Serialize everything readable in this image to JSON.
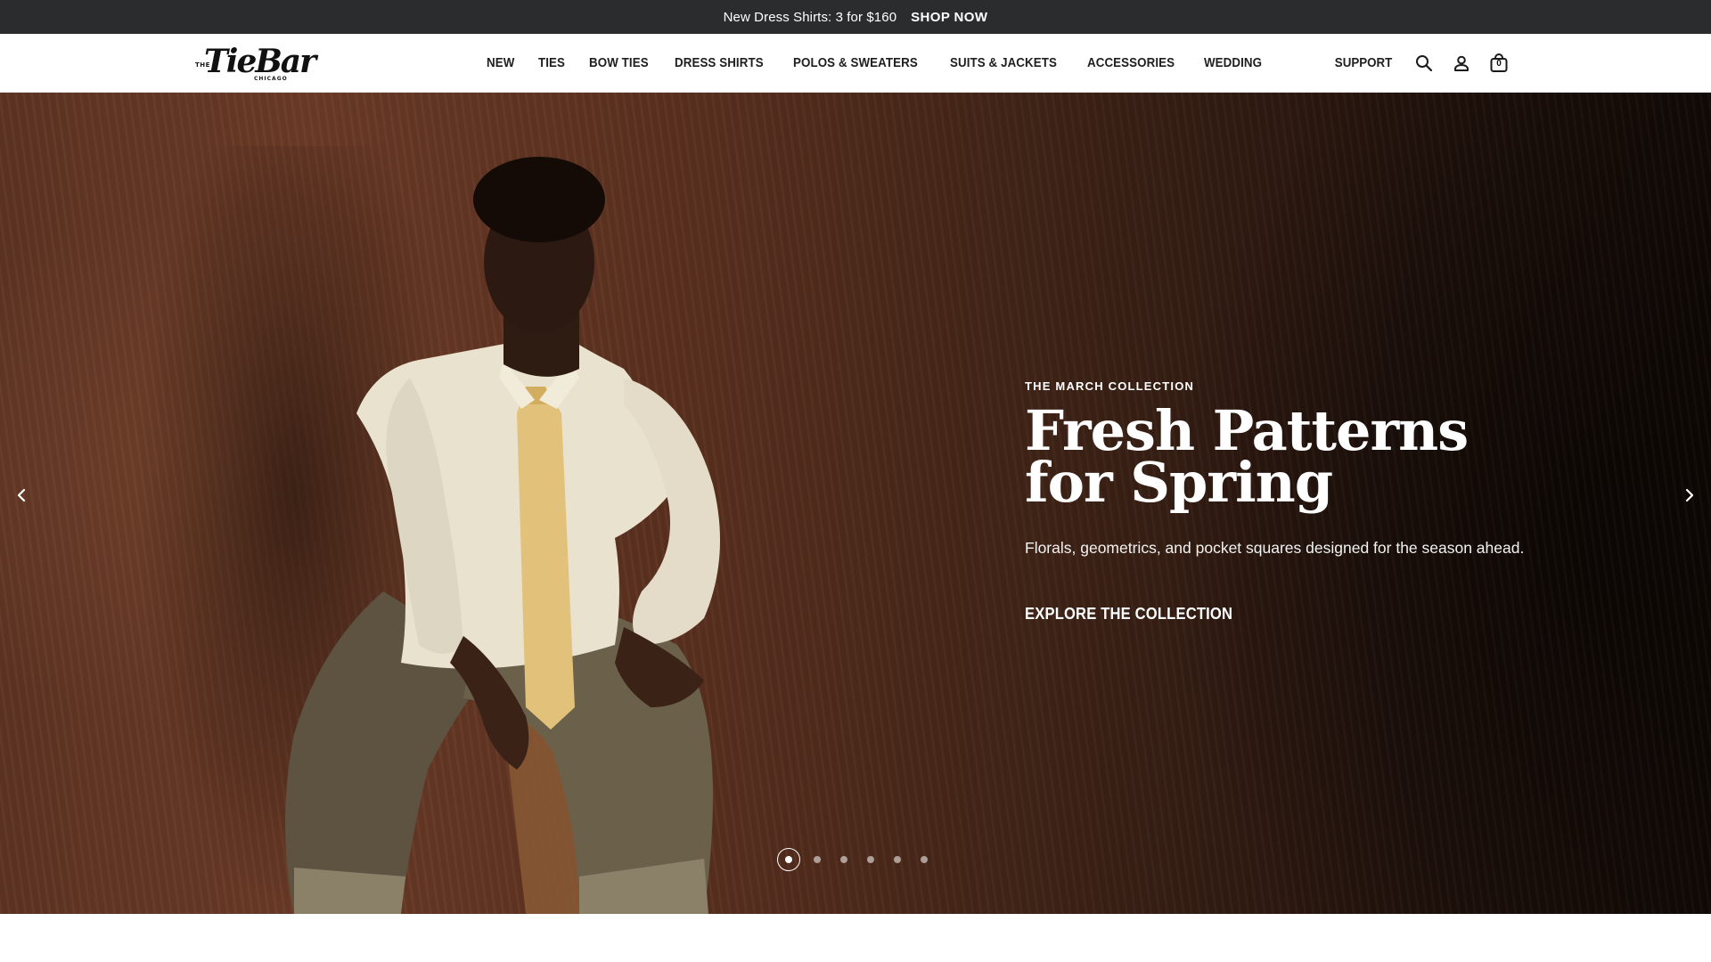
{
  "announcement": {
    "message": "New Dress Shirts: 3 for $160",
    "cta": "SHOP NOW"
  },
  "logo": {
    "the": "THE",
    "wordmark": "TieBar",
    "city": "CHICAGO"
  },
  "nav": {
    "items": [
      {
        "label": "NEW"
      },
      {
        "label": "TIES"
      },
      {
        "label": "BOW TIES"
      },
      {
        "label": "DRESS SHIRTS"
      },
      {
        "label": "POLOS & SWEATERS"
      },
      {
        "label": "SUITS & JACKETS"
      },
      {
        "label": "ACCESSORIES"
      },
      {
        "label": "WEDDING"
      }
    ]
  },
  "utils": {
    "support": "SUPPORT",
    "search_icon": "search-icon",
    "account_icon": "account-icon",
    "cart_icon": "shopping-bag-icon",
    "cart_count": "0"
  },
  "hero": {
    "eyebrow": "THE MARCH COLLECTION",
    "headline_line1": "Fresh Patterns",
    "headline_line2": "for Spring",
    "subhead": "Florals, geometrics, and pocket squares designed for the season ahead.",
    "cta": "EXPLORE THE COLLECTION",
    "prev_icon": "chevron-left-icon",
    "next_icon": "chevron-right-icon",
    "slides_total": 6,
    "active_slide": 1
  },
  "colors": {
    "announcement_bg": "#2b2c2e",
    "hero_brown": "#5e3423",
    "hero_dark": "#120a06",
    "text_light": "#ffffff"
  }
}
